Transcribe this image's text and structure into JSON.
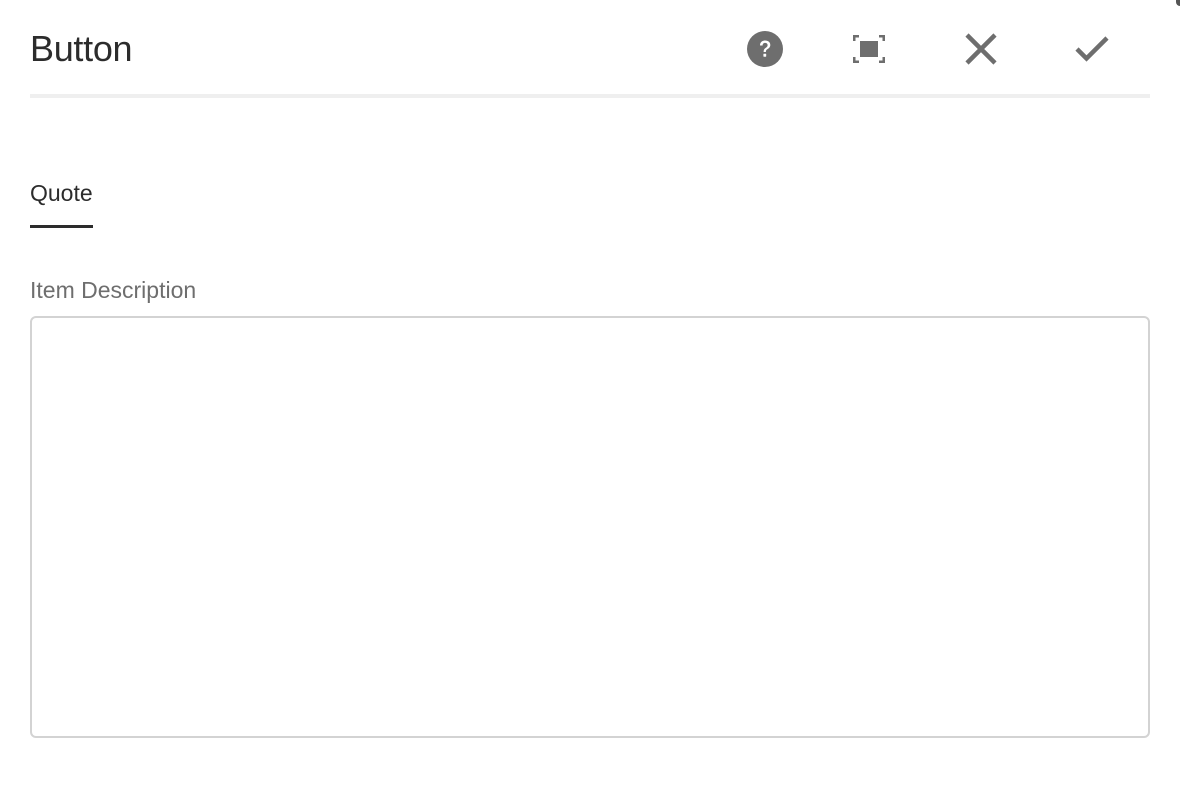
{
  "dialog": {
    "title": "Button",
    "actions": {
      "help_icon": "help-circle-icon",
      "fullscreen_icon": "fullscreen-icon",
      "close_icon": "close-icon",
      "done_icon": "checkmark-icon"
    }
  },
  "tabs": [
    {
      "label": "Quote",
      "selected": true
    }
  ],
  "form": {
    "item_description": {
      "label": "Item Description",
      "value": "",
      "placeholder": ""
    }
  },
  "colors": {
    "icon": "#6e6e6e",
    "text": "#2c2c2c",
    "label": "#6e6e6e",
    "border": "#d3d3d3",
    "divider": "#efefef"
  }
}
